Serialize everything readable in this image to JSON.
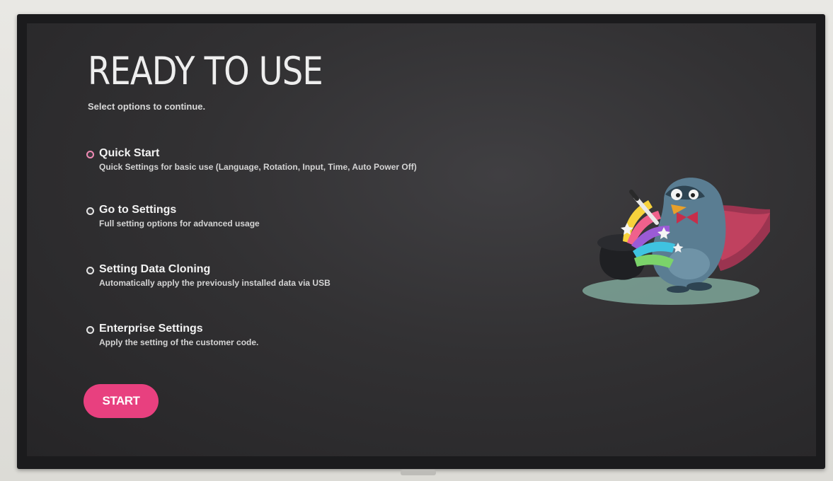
{
  "screen": {
    "title": "READY TO USE",
    "subtitle": "Select options to continue."
  },
  "options": [
    {
      "title": "Quick Start",
      "description": "Quick Settings for basic use (Language, Rotation, Input, Time, Auto Power Off)",
      "selected": true
    },
    {
      "title": "Go to Settings",
      "description": "Full setting options for advanced usage",
      "selected": false
    },
    {
      "title": "Setting Data Cloning",
      "description": "Automatically apply the previously installed data via USB",
      "selected": false
    },
    {
      "title": "Enterprise Settings",
      "description": "Apply the setting of the customer code.",
      "selected": false
    }
  ],
  "start_button": {
    "label": "START"
  },
  "colors": {
    "accent": "#e8407f",
    "selected_radio": "#f08ab4",
    "screen_background": "#323133"
  },
  "icons": {
    "mascot": "penguin-magician-illustration"
  }
}
